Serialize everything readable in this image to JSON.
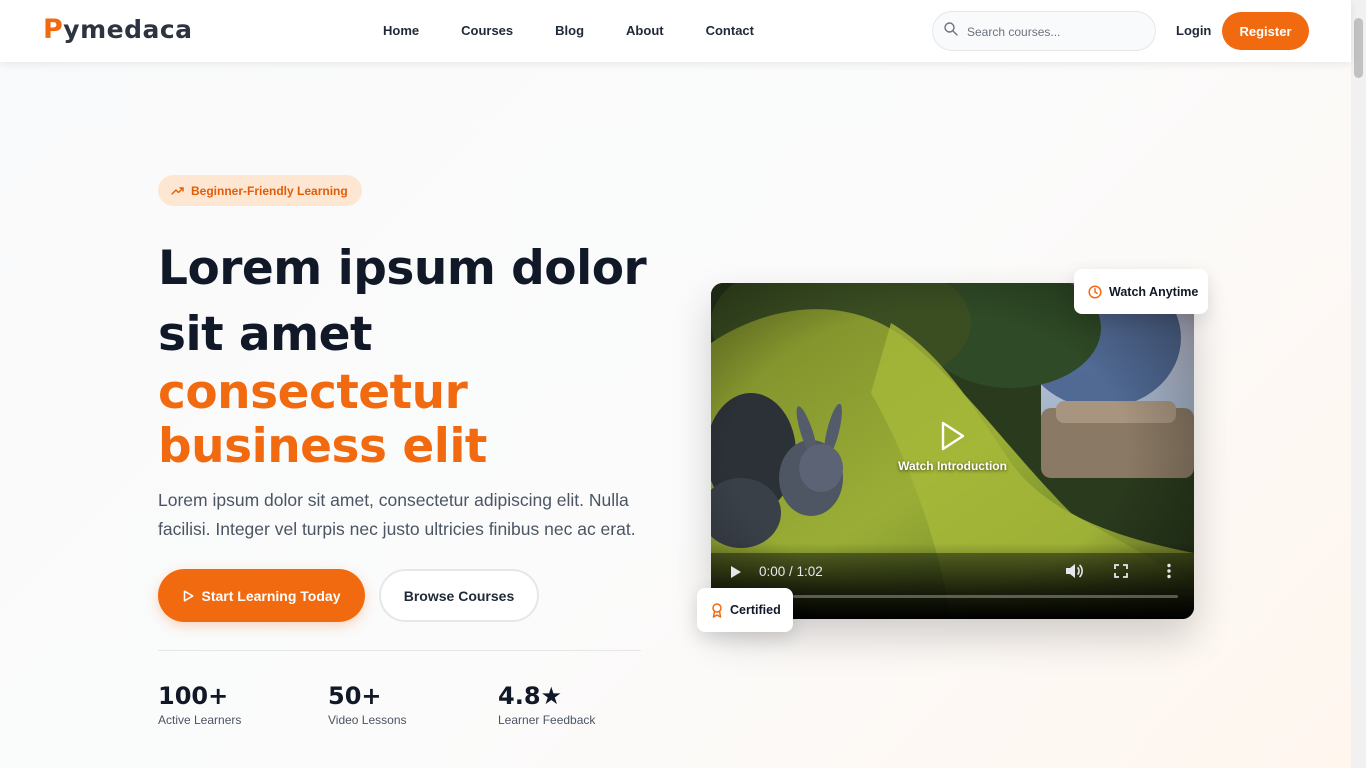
{
  "brand": {
    "first_letter": "P",
    "rest": "ymedaca"
  },
  "nav": {
    "links": [
      "Home",
      "Courses",
      "Blog",
      "About",
      "Contact"
    ],
    "search_placeholder": "Search courses...",
    "login": "Login",
    "register": "Register"
  },
  "hero": {
    "badge": "Beginner-Friendly Learning",
    "headline": "Lorem ipsum dolor sit amet",
    "headline_accent": "consectetur business elit",
    "description": "Lorem ipsum dolor sit amet, consectetur adipiscing elit. Nulla facilisi. Integer vel turpis nec justo ultricies finibus nec ac erat.",
    "primary_button": "Start Learning Today",
    "secondary_button": "Browse Courses",
    "stats": [
      {
        "value": "100+",
        "label": "Active Learners"
      },
      {
        "value": "50+",
        "label": "Video Lessons"
      },
      {
        "value": "4.8★",
        "label": "Learner Feedback"
      }
    ]
  },
  "video": {
    "overlay_label": "Watch Introduction",
    "time": "0:00 / 1:02",
    "progress": 0,
    "badge_top": "Watch Anytime",
    "badge_bottom": "Certified"
  },
  "colors": {
    "accent": "#f26a10",
    "text": "#111827",
    "muted": "#4b5563",
    "badge_bg": "#fde6d2"
  }
}
